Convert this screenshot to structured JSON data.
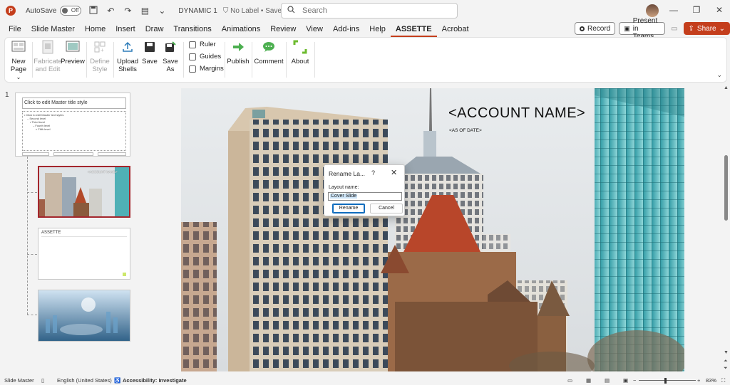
{
  "titlebar": {
    "app_logo": "P",
    "autosave_label": "AutoSave",
    "autosave_state": "Off",
    "doc_title": "DYNAMIC 1",
    "label_status": "No Label • Saved to this PC",
    "label_chevron": "⌄",
    "search_placeholder": "Search",
    "icons": [
      "save-icon",
      "undo-icon",
      "redo-icon",
      "customize-icon"
    ]
  },
  "menu": {
    "items": [
      "File",
      "Slide Master",
      "Home",
      "Insert",
      "Draw",
      "Transitions",
      "Animations",
      "Review",
      "View",
      "Add-ins",
      "Help",
      "ASSETTE",
      "Acrobat"
    ],
    "active": "ASSETTE",
    "record_label": "Record",
    "teams_label": "Present in Teams",
    "share_label": "Share"
  },
  "ribbon": {
    "new_page": "New Page",
    "new_page_chevron": "⌄",
    "fabricate": "Fabricate and Edit",
    "preview": "Preview",
    "define_style": "Define Style",
    "upload_shells": "Upload Shells",
    "save": "Save",
    "save_as": "Save As",
    "ruler": "Ruler",
    "guides": "Guides",
    "margins": "Margins",
    "publish": "Publish",
    "comment": "Comment",
    "about": "About"
  },
  "thumbs": {
    "slide_number": "1",
    "master_title": "Click to edit Master title style",
    "master_body": [
      "• Click to edit Master text styles",
      "– Second level",
      "• Third level",
      "– Fourth level",
      "» Fifth level"
    ],
    "layout2_title": "<ACCOUNT NAME>",
    "layout3_brand": "ASSETTE"
  },
  "slide": {
    "account_name": "<ACCOUNT NAME>",
    "as_of_date": "<AS OF DATE>"
  },
  "dialog": {
    "title": "Rename La...",
    "help": "?",
    "close": "✕",
    "field_label": "Layout name:",
    "field_value": "Cover Slide",
    "rename_button": "Rename",
    "cancel_button": "Cancel"
  },
  "status": {
    "view": "Slide Master",
    "language": "English (United States)",
    "accessibility": "Accessibility: Investigate",
    "zoom": "83%"
  },
  "colors": {
    "accent": "#c43e1c",
    "selection": "#a4262c"
  }
}
